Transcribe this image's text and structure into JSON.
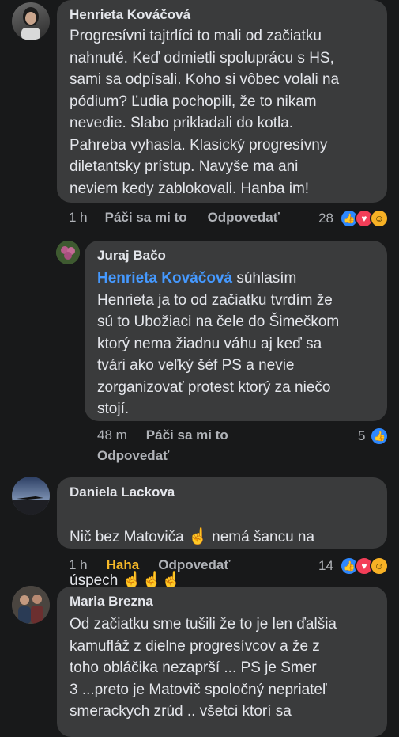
{
  "comments": [
    {
      "author": "Henrieta Kováčová",
      "text": "Progresívni tajtrlíci to mali od začiatku\nnahnuté. Keď odmietli spoluprácu s HS,\nsami sa odpísali. Koho si vôbec volali na\npódium? Ľudia pochopili, že to nikam\nnevedie. Slabo prikladali do kotla.\nPahreba vyhasla. Klasický progresívny\ndiletantsky prístup. Navyše ma ani\nneviem kedy zablokovali. Hanba im!",
      "time": "1 h",
      "like_label": "Páči sa mi to",
      "reply_label": "Odpovedať",
      "reaction_count": "28"
    },
    {
      "author": "Juraj Bačo",
      "mention": "Henrieta Kováčová",
      "text_after_mention": " súhlasím\nHenrieta ja to od začiatku tvrdím že\nsú to Ubožiaci na čele do Šimečkom\nktorý nema žiadnu váhu  aj keď sa\ntvári ako veľký šéf PS a nevie\nzorganizovať protest ktorý za niečo\nstojí.",
      "time": "48 m",
      "like_label": "Páči sa mi to",
      "reply_label": "Odpovedať",
      "reaction_count": "5"
    },
    {
      "author": "Daniela Lackova",
      "text_line1": "Nič bez Matoviča ",
      "text_line1_end": " nemá šancu na",
      "text_line2": "úspech ",
      "hand": "☝",
      "time": "1 h",
      "like_label": "Haha",
      "reply_label": "Odpovedať",
      "reaction_count": "14",
      "like_active_color": "#f7b928"
    },
    {
      "author": "Maria Brezna",
      "text": "Od začiatku sme tušili že to je len ďalšia\nkamufláž z dielne progresívcov  a že z\ntoho obláčika nezaprší ... PS je Smer\n3 ...preto je Matovič spoločný nepriateľ\nsmerackych zrúd .. všetci ktorí sa"
    }
  ]
}
